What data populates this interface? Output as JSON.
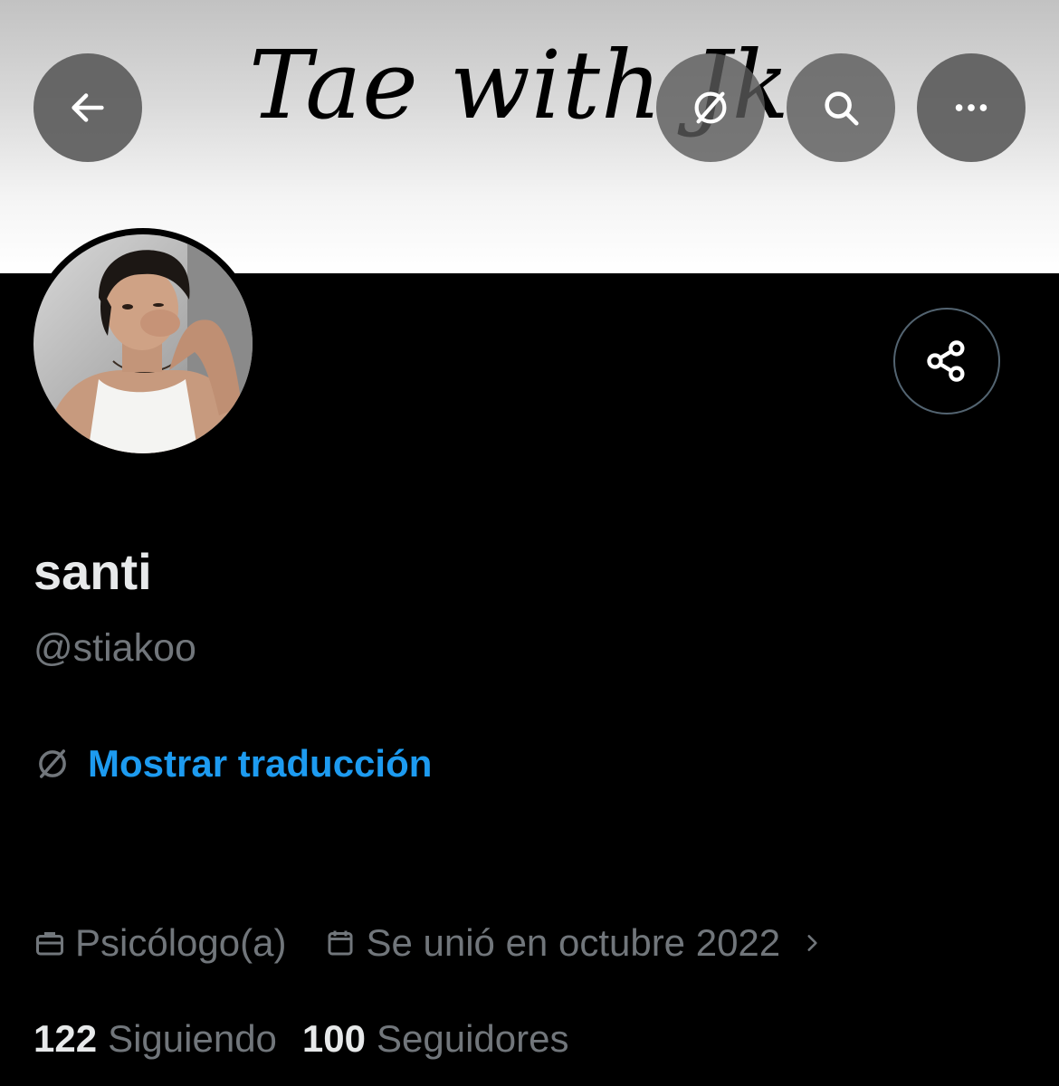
{
  "banner": {
    "text": "Tae with Jk"
  },
  "header": {
    "back_icon": "arrow-left-icon",
    "translate_icon": "translate-icon",
    "search_icon": "search-icon",
    "more_icon": "more-horizontal-icon"
  },
  "profile": {
    "display_name": "santi",
    "handle": "@stiakoo",
    "translate_link": "Mostrar traducción",
    "profession": "Psicólogo(a)",
    "joined": "Se unió en octubre 2022",
    "following_count": "122",
    "following_label": "Siguiendo",
    "followers_count": "100",
    "followers_label": "Seguidores"
  },
  "colors": {
    "background": "#000000",
    "link": "#1d9bf0",
    "secondary_text": "#71767b",
    "primary_text": "#e7e9ea"
  }
}
